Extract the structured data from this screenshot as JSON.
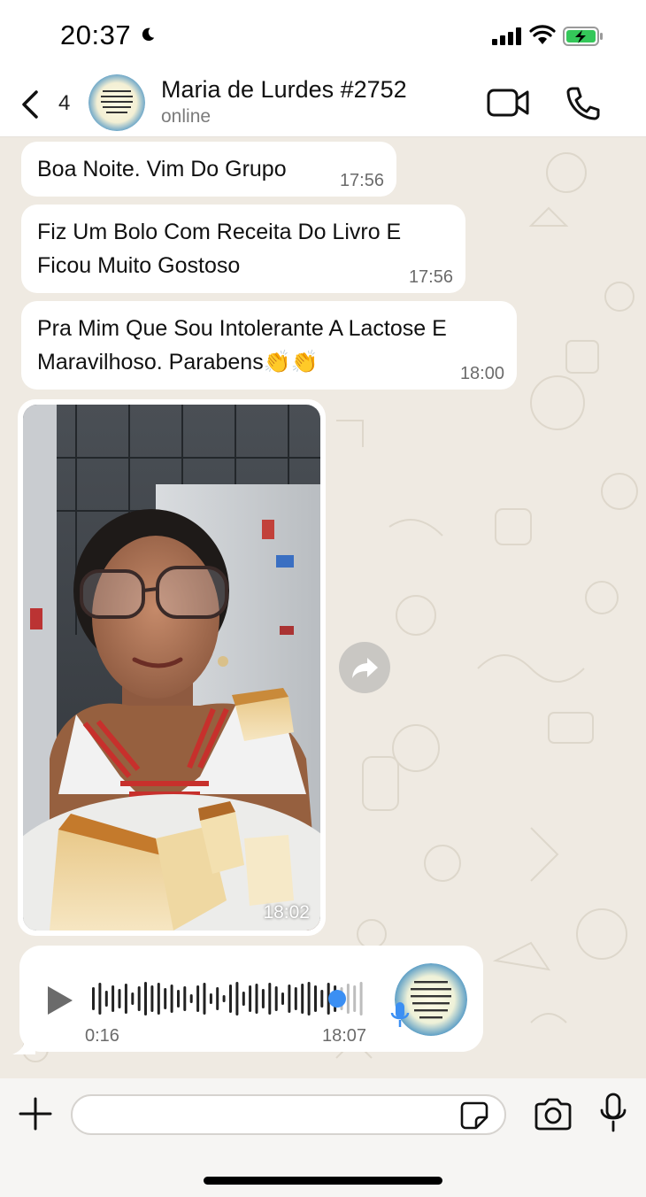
{
  "status_bar": {
    "time": "20:37"
  },
  "header": {
    "back_count": "4",
    "contact_name": "Maria de Lurdes #2752",
    "contact_status": "online",
    "avatar_text": "Que Deus abençoe o seu dia e lhe conceda sucesso em todos os projetos. Bom dia!"
  },
  "messages": [
    {
      "text": "Boa Noite. Vim Do Grupo",
      "time": "17:56"
    },
    {
      "text": "Fiz Um Bolo Com Receita Do Livro E Ficou Muito Gostoso",
      "time": "17:56"
    },
    {
      "text": "Pra Mim Que Sou Intolerante A Lactose E Maravilhoso. Parabens👏👏",
      "time": "18:00"
    }
  ],
  "image_message": {
    "time": "18:02"
  },
  "voice_message": {
    "duration": "0:16",
    "time": "18:07",
    "progress": 0.9
  },
  "input": {
    "placeholder": ""
  },
  "colors": {
    "chat_background": "#efeae2",
    "bubble": "#ffffff",
    "voice_accent": "#3b8ff3",
    "battery_green": "#34c759"
  },
  "icons": [
    "back-chevron-icon",
    "video-call-icon",
    "phone-icon",
    "forward-icon",
    "play-icon",
    "microphone-icon",
    "plus-icon",
    "sticker-icon",
    "camera-icon",
    "moon-icon",
    "signal-icon",
    "wifi-icon",
    "battery-icon"
  ]
}
